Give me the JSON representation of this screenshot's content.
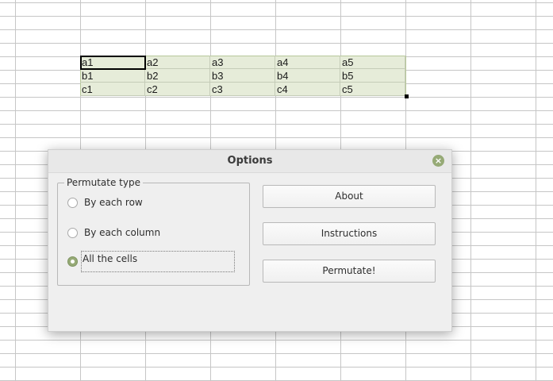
{
  "sheet": {
    "rows": [
      [
        "a1",
        "a2",
        "a3",
        "a4",
        "a5"
      ],
      [
        "b1",
        "b2",
        "b3",
        "b4",
        "b5"
      ],
      [
        "c1",
        "c2",
        "c3",
        "c4",
        "c5"
      ]
    ]
  },
  "dialog": {
    "title": "Options",
    "close_icon": "close-icon",
    "group": {
      "legend": "Permutate type",
      "options": [
        {
          "label": "By each row",
          "checked": false
        },
        {
          "label": "By each column",
          "checked": false
        },
        {
          "label": "All the cells",
          "checked": true
        }
      ]
    },
    "buttons": {
      "about": "About",
      "instructions": "Instructions",
      "permutate": "Permutate!"
    }
  },
  "colors": {
    "accent": "#96aa76",
    "selection_fill": "#e6ecd9"
  }
}
